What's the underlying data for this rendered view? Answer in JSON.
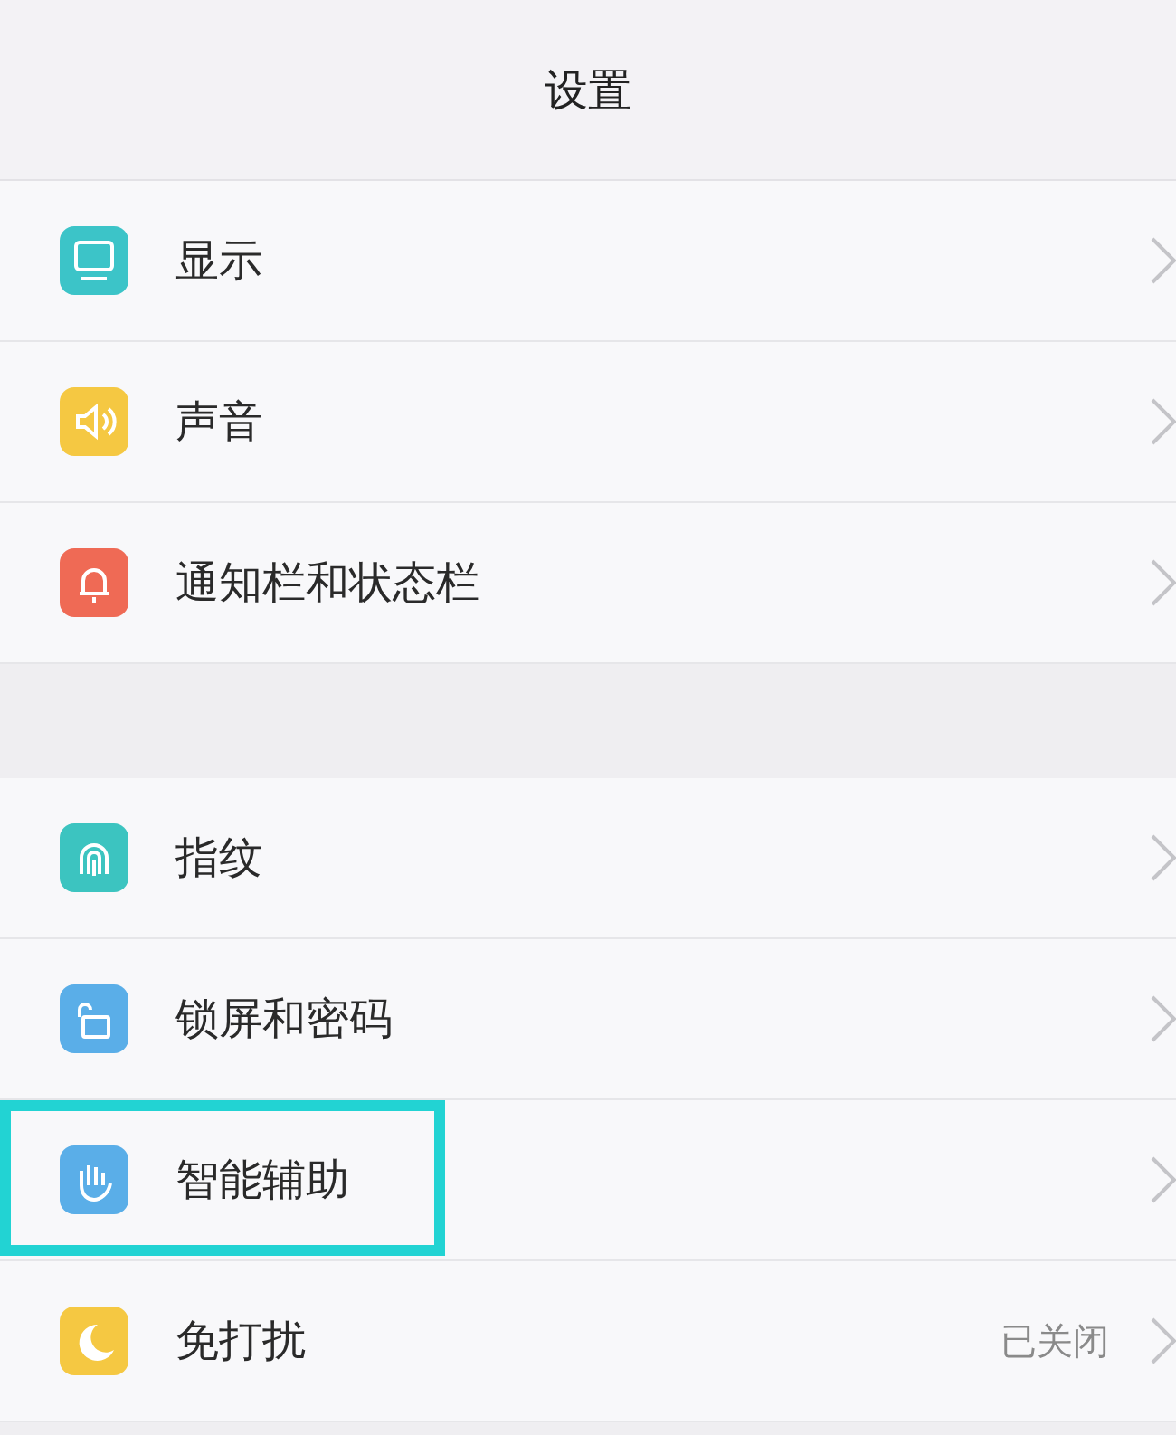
{
  "header": {
    "title": "设置"
  },
  "groups": [
    {
      "items": [
        {
          "label": "显示",
          "color": "#3cc4c8",
          "highlighted": false
        },
        {
          "label": "声音",
          "color": "#f5c842",
          "highlighted": false
        },
        {
          "label": "通知栏和状态栏",
          "color": "#ef6a55",
          "highlighted": false
        }
      ]
    },
    {
      "items": [
        {
          "label": "指纹",
          "color": "#3cc4c0",
          "highlighted": false
        },
        {
          "label": "锁屏和密码",
          "color": "#5aaee8",
          "highlighted": false
        },
        {
          "label": "智能辅助",
          "color": "#5aaee8",
          "highlighted": true
        },
        {
          "label": "免打扰",
          "color": "#f5c842",
          "highlighted": false,
          "value": "已关闭"
        }
      ]
    }
  ]
}
